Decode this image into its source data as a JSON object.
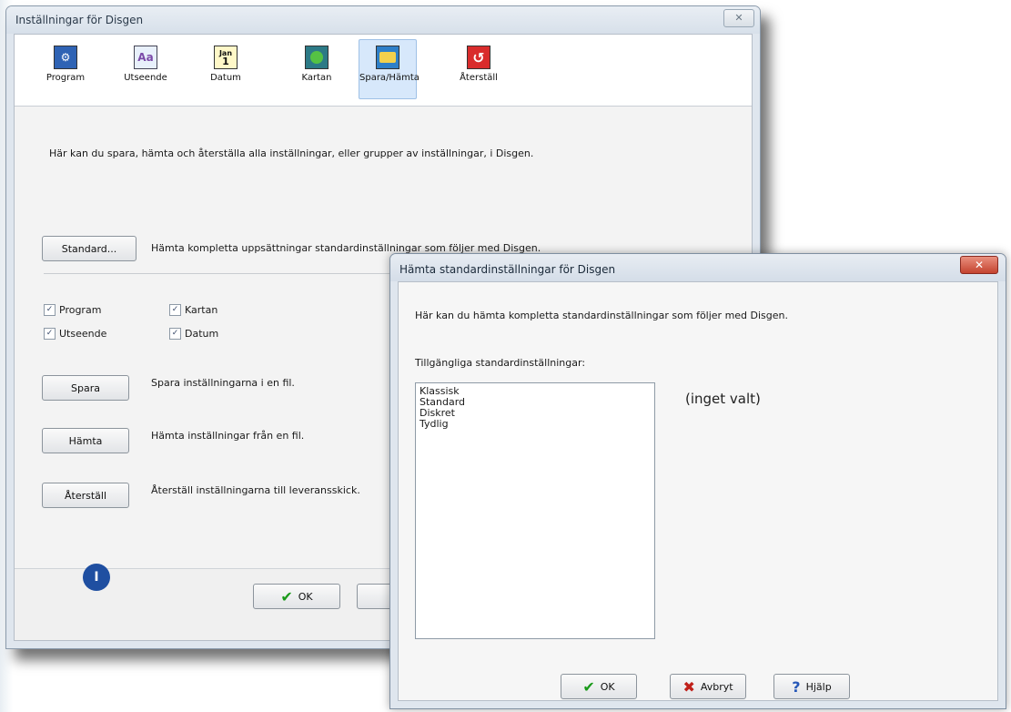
{
  "main_window": {
    "title": "Inställningar för Disgen",
    "close_label": "✕",
    "toolbar": [
      {
        "label": "Program",
        "icon": "program-icon"
      },
      {
        "label": "Utseende",
        "icon": "appearance-icon"
      },
      {
        "label": "Datum",
        "icon": "calendar-icon",
        "icon_text_top": "Jan",
        "icon_text_bottom": "1"
      },
      {
        "label": "Kartan",
        "icon": "map-icon"
      },
      {
        "label": "Spara/Hämta",
        "icon": "folder-icon"
      },
      {
        "label": "Återställ",
        "icon": "reset-icon"
      }
    ],
    "intro": "Här kan du spara, hämta och återställa alla inställningar, eller grupper av inställningar, i Disgen.",
    "standard_button": "Standard...",
    "standard_desc": "Hämta kompletta uppsättningar standardinställningar som följer med Disgen.",
    "checkboxes": [
      {
        "label": "Program",
        "checked": true
      },
      {
        "label": "Kartan",
        "checked": true
      },
      {
        "label": "Utseende",
        "checked": true
      },
      {
        "label": "Datum",
        "checked": true
      }
    ],
    "save_button": "Spara",
    "save_desc": "Spara inställningarna i en fil.",
    "load_button": "Hämta",
    "load_desc": "Hämta inställningar från en fil.",
    "reset_button": "Återställ",
    "reset_desc": "Återställ inställningarna till leveransskick.",
    "ok_button": "OK",
    "badge": "I"
  },
  "dialog": {
    "title": "Hämta standardinställningar för Disgen",
    "close_label": "✕",
    "intro": "Här kan du hämta kompletta standardinställningar som följer med Disgen.",
    "list_label": "Tillgängliga standardinställningar:",
    "list_items": [
      "Klassisk",
      "Standard",
      "Diskret",
      "Tydlig"
    ],
    "selection": "(inget valt)",
    "ok_button": "OK",
    "cancel_button": "Avbryt",
    "help_button": "Hjälp"
  },
  "colors": {
    "accent_selected": "#d7e8fb",
    "close_red": "#c4432f",
    "badge_blue": "#1f4fa1"
  }
}
